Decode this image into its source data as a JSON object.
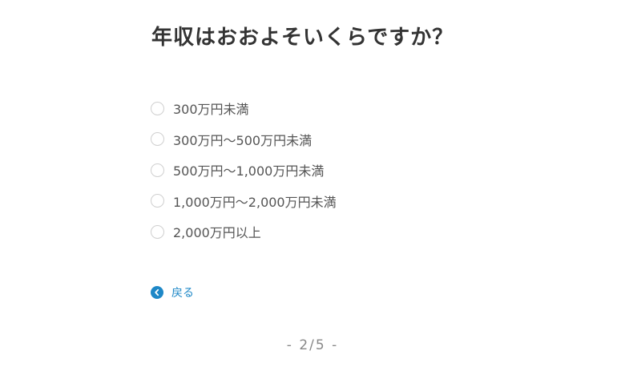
{
  "question": {
    "title": "年収はおおよそいくらですか？"
  },
  "options": [
    {
      "label": "300万円未満"
    },
    {
      "label": "300万円～500万円未満"
    },
    {
      "label": "500万円～1,000万円未満"
    },
    {
      "label": "1,000万円～2,000万円未満"
    },
    {
      "label": "2,000万円以上"
    }
  ],
  "navigation": {
    "back_label": "戻る",
    "back_icon": "chevron-left-circle-icon"
  },
  "pager": {
    "text": "- 2/5 -"
  },
  "colors": {
    "accent": "#1e88c7",
    "text": "#333333",
    "radio_border": "#cfcfcf"
  }
}
